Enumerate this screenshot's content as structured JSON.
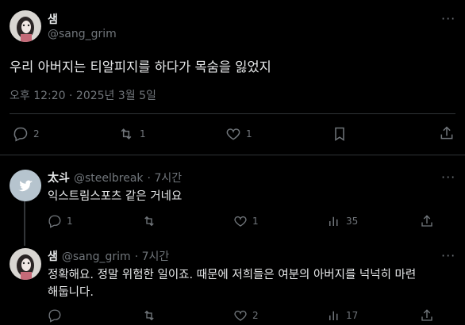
{
  "main_post": {
    "display_name": "샘",
    "handle": "@sang_grim",
    "text": "우리 아버지는 티알피지를 하다가 목숨을 잃었지",
    "timestamp": "오후 12:20 · 2025년 3월 5일",
    "actions": {
      "replies": "2",
      "reposts": "1",
      "likes": "1"
    }
  },
  "replies": [
    {
      "display_name": "太斗",
      "handle": "@steelbreak",
      "time": "· 7시간",
      "text": "익스트림스포츠 같은 거네요",
      "actions": {
        "replies": "1",
        "reposts": "",
        "likes": "1",
        "views": "35"
      }
    },
    {
      "display_name": "샘",
      "handle": "@sang_grim",
      "time": "· 7시간",
      "text_line1": "정확해요. 정말 위험한 일이죠. 때문에 저희들은 여분의 아버지를 넉넉히 마련",
      "text_line2": "해둡니다.",
      "actions": {
        "replies": "",
        "reposts": "",
        "likes": "2",
        "views": "17"
      }
    }
  ],
  "more_label": "···",
  "colors": {
    "background": "#000000",
    "text": "#e7e9ea",
    "muted": "#71767b",
    "divider": "#2f3336",
    "twitter_blue": "#1d9bf0"
  },
  "icons": [
    "reply-icon",
    "repost-icon",
    "like-icon",
    "bookmark-icon",
    "share-icon",
    "views-icon",
    "more-icon",
    "twitter-bird-icon"
  ]
}
